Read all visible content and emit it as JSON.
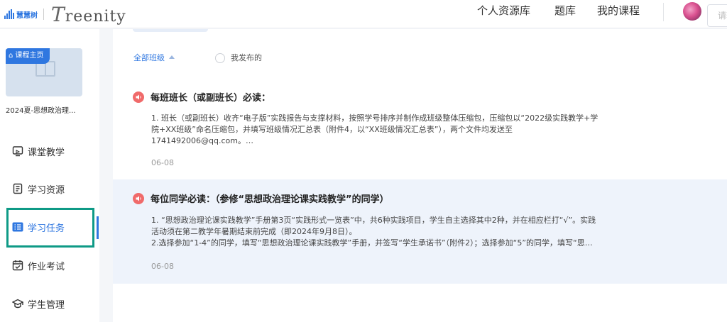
{
  "header": {
    "logo_cn": "慧慧树",
    "logo_en_initial": "T",
    "logo_en_rest": "reenity",
    "nav": [
      "个人资源库",
      "题库",
      "我的课程"
    ],
    "search_placeholder": "请输入"
  },
  "sidebar": {
    "home_badge": "课程主页",
    "course_name": "2024夏-思想政治理...",
    "items": [
      {
        "label": "课堂教学",
        "icon": "monitor-icon",
        "active": false
      },
      {
        "label": "学习资源",
        "icon": "document-icon",
        "active": false
      },
      {
        "label": "学习任务",
        "icon": "task-list-icon",
        "active": true
      },
      {
        "label": "作业考试",
        "icon": "calendar-icon",
        "active": false
      },
      {
        "label": "学生管理",
        "icon": "graduation-cap-icon",
        "active": false
      }
    ]
  },
  "filters": {
    "all_classes": "全部班级",
    "mine": "我发布的"
  },
  "notices": [
    {
      "title": "每班班长（或副班长）必读：",
      "lines": [
        "1. 班长（或副班长）收齐“电子版”实践报告与支撑材料，按照学号排序并制作成班级整体压缩包，压缩包以“2022级实践教学+学",
        "院+XX班级”命名压缩包，并填写班级情况汇总表（附件4，以“XX班级情况汇总表”），两个文件均发送至",
        "1741492006@qq.com。…"
      ],
      "date": "06-08"
    },
    {
      "title": "每位同学必读：（参修“思想政治理论课实践教学”的同学）",
      "lines": [
        "1. “思想政治理论课实践教学”手册第3页“实践形式一览表”中，共6种实践项目，学生自主选择其中2种，并在相应栏打“√”。实践",
        "活动须在第二教学年暑期结束前完成（即2024年9月8日）。",
        "2.选择参加“1-4”的同学，填写“思想政治理论课实践教学”手册，并签写“学生承诺书”（附件2）；选择参加“5”的同学，填写“思…"
      ],
      "date": "06-08"
    }
  ],
  "colors": {
    "accent": "#2f77e0",
    "highlight_box": "#0e9a86",
    "notice_icon": "#f06a6a",
    "selected_row_bg": "#eef3fb"
  }
}
